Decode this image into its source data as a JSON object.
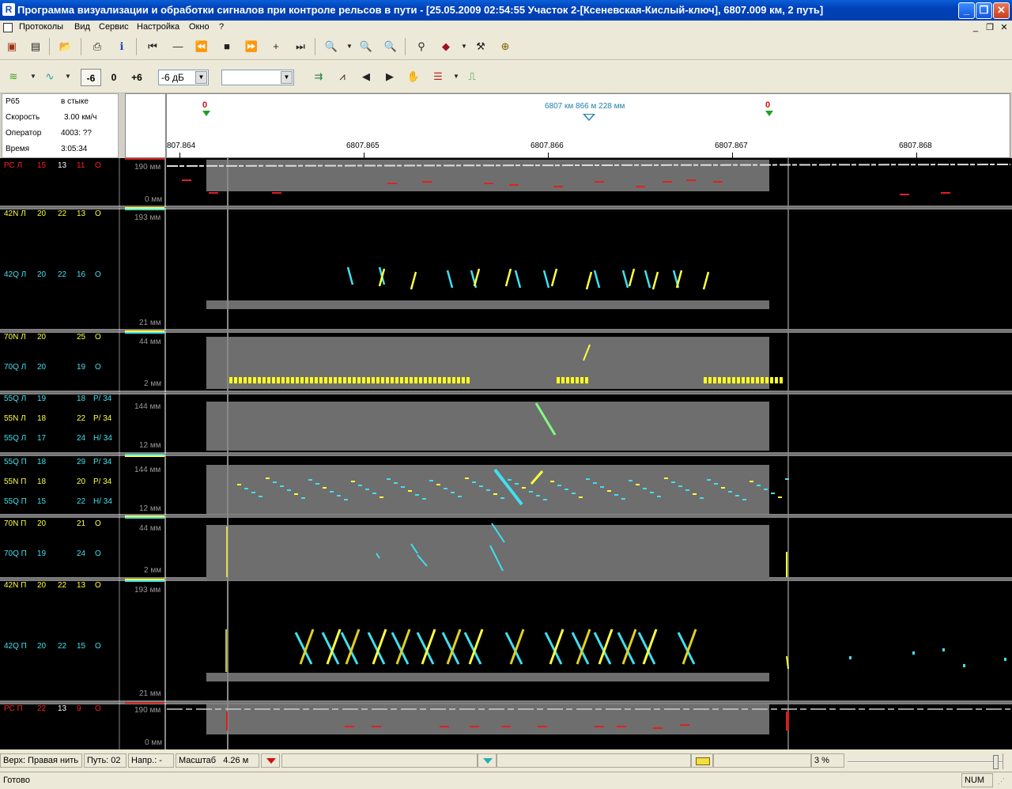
{
  "window": {
    "title": "Программа визуализации и обработки сигналов при контроле рельсов в пути - [25.05.2009 02:54:55 Участок 2-[Ксеневская-Кислый-ключ], 6807.009 км, 2 путь]",
    "min": "_",
    "max": "❐",
    "close": "✕"
  },
  "menu": [
    "Протоколы",
    "Вид",
    "Сервис",
    "Настройка",
    "Окно",
    "?"
  ],
  "toolbar2": {
    "minus6": "-6",
    "zero": "0",
    "plus6": "+6",
    "gain_combo": "-6 дБ",
    "empty_combo": ""
  },
  "info": {
    "r65_label": "Р65",
    "r65_value": "в стыке",
    "speed_label": "Скорость",
    "speed_value": "3.00 км/ч",
    "operator_label": "Оператор",
    "operator_value": "4003: ??",
    "time_label": "Время",
    "time_value": "3:05:34"
  },
  "ruler": {
    "marker_label": "6807 км 866 м 228 мм",
    "flag0": "0",
    "flag1": "0",
    "ticks": [
      "807.864",
      "6807.865",
      "6807.866",
      "6807.867",
      "6807.868"
    ]
  },
  "channels": [
    {
      "name": "РС Л",
      "a": "15",
      "b": "13",
      "c": "11",
      "d": "О",
      "color": "#ff2020"
    },
    {
      "name": "42N Л",
      "a": "20",
      "b": "22",
      "c": "13",
      "d": "О",
      "color": "#ffff40"
    },
    {
      "name": "42Q Л",
      "a": "20",
      "b": "22",
      "c": "16",
      "d": "О",
      "color": "#40e0f0"
    },
    {
      "name": "70N Л",
      "a": "20",
      "b": "",
      "c": "25",
      "d": "О",
      "color": "#ffff40"
    },
    {
      "name": "70Q Л",
      "a": "20",
      "b": "",
      "c": "19",
      "d": "О",
      "color": "#40e0f0"
    },
    {
      "name": "55Q Л",
      "a": "19",
      "b": "",
      "c": "18",
      "d": "Р/ 34",
      "color": "#40e0f0"
    },
    {
      "name": "55N Л",
      "a": "18",
      "b": "",
      "c": "22",
      "d": "Р/ 34",
      "color": "#ffff40"
    },
    {
      "name": "55Q Л",
      "a": "17",
      "b": "",
      "c": "24",
      "d": "Н/ 34",
      "color": "#40e0f0"
    },
    {
      "name": "55Q П",
      "a": "18",
      "b": "",
      "c": "29",
      "d": "Р/ 34",
      "color": "#40e0f0"
    },
    {
      "name": "55N П",
      "a": "18",
      "b": "",
      "c": "20",
      "d": "Р/ 34",
      "color": "#ffff40"
    },
    {
      "name": "55Q П",
      "a": "15",
      "b": "",
      "c": "22",
      "d": "Н/ 34",
      "color": "#40e0f0"
    },
    {
      "name": "70N П",
      "a": "20",
      "b": "",
      "c": "21",
      "d": "О",
      "color": "#ffff40"
    },
    {
      "name": "70Q П",
      "a": "19",
      "b": "",
      "c": "24",
      "d": "О",
      "color": "#40e0f0"
    },
    {
      "name": "42N П",
      "a": "20",
      "b": "22",
      "c": "13",
      "d": "О",
      "color": "#ffff40"
    },
    {
      "name": "42Q П",
      "a": "20",
      "b": "22",
      "c": "15",
      "d": "О",
      "color": "#40e0f0"
    },
    {
      "name": "РС П",
      "a": "22",
      "b": "13",
      "c": "9",
      "d": "О",
      "color": "#ff2020"
    }
  ],
  "scales": [
    {
      "top": "190 мм",
      "bottom": "0 мм"
    },
    {
      "top": "193 мм",
      "bottom": "21 мм"
    },
    {
      "top": "44 мм",
      "bottom": "2 мм"
    },
    {
      "top": "144 мм",
      "bottom": "12 мм"
    },
    {
      "top": "144 мм",
      "bottom": "12 мм"
    },
    {
      "top": "44 мм",
      "bottom": "2 мм"
    },
    {
      "top": "193 мм",
      "bottom": "21 мм"
    },
    {
      "top": "190 мм",
      "bottom": "0 мм"
    }
  ],
  "status": {
    "top_thread": "Верх: Правая нить",
    "track": "Путь: 02",
    "direction": "Напр.: -",
    "scale_label": "Масштаб",
    "scale_value": "4.26 м",
    "percent": "3 %",
    "ready": "Готово",
    "num": "NUM"
  }
}
